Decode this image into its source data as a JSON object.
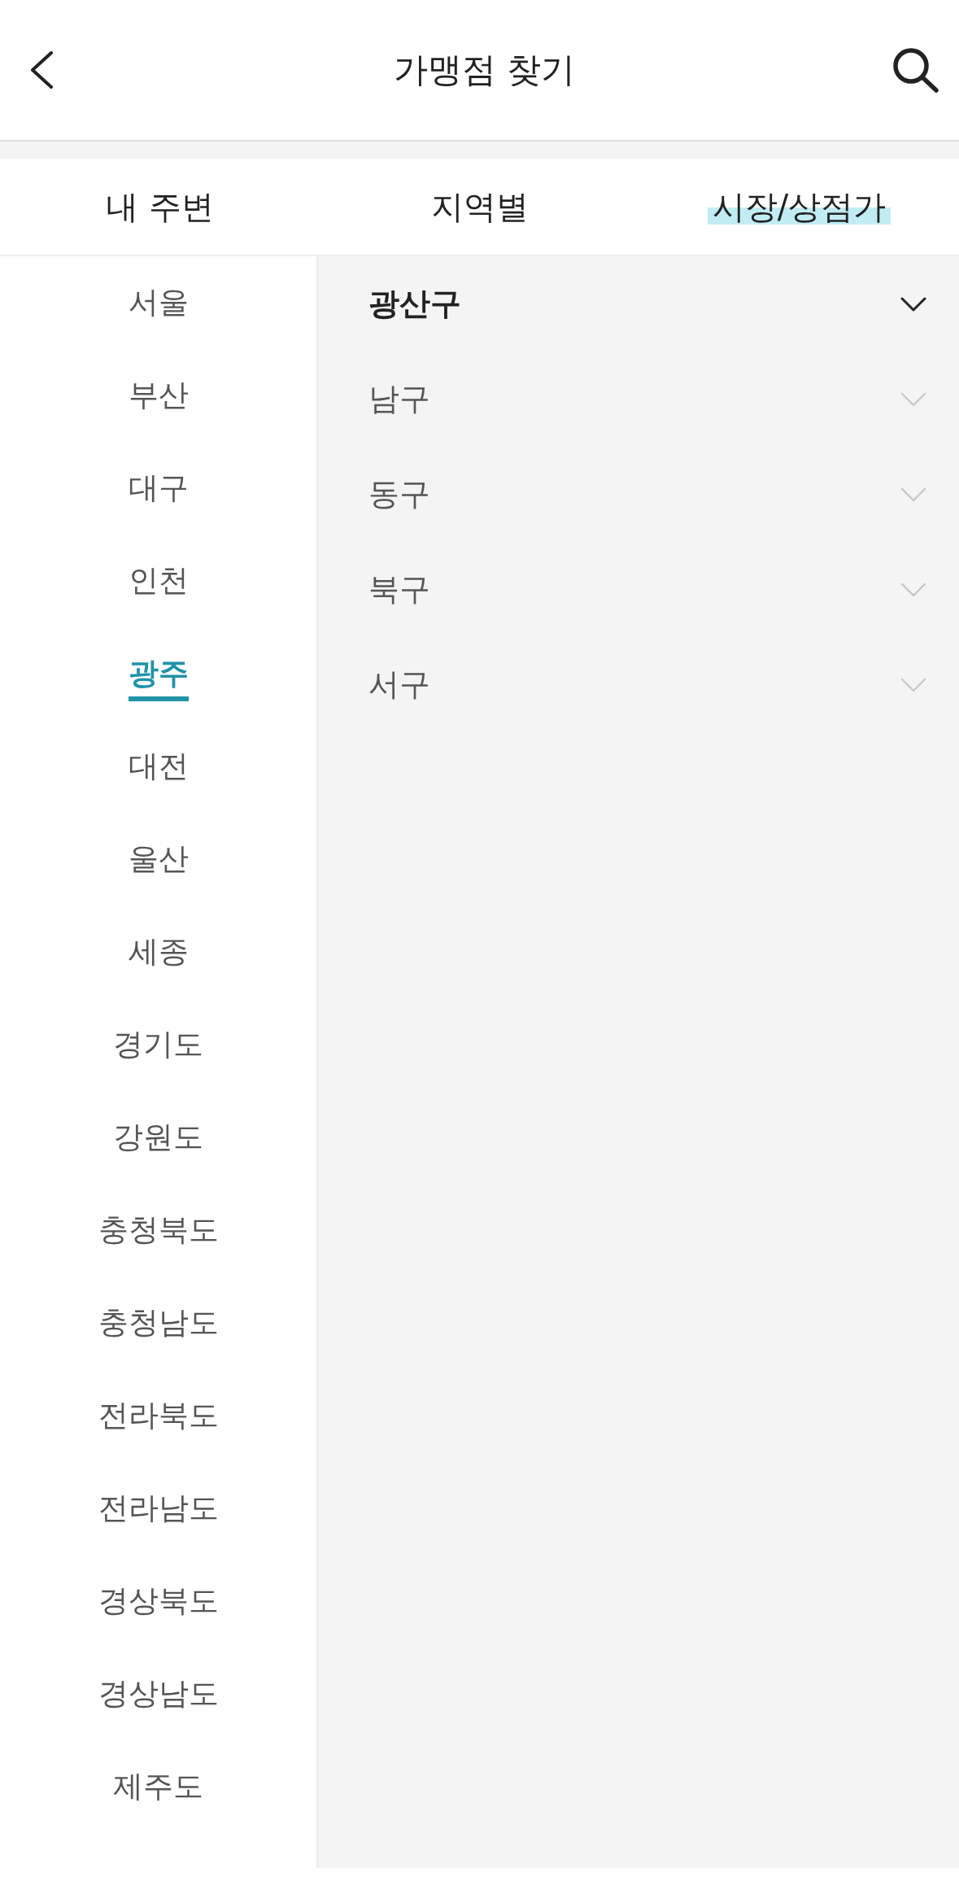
{
  "header": {
    "title": "가맹점 찾기"
  },
  "tabs": [
    {
      "label": "내 주변",
      "selected": false
    },
    {
      "label": "지역별",
      "selected": false
    },
    {
      "label": "시장/상점가",
      "selected": true
    }
  ],
  "regions": [
    {
      "label": "서울",
      "selected": false
    },
    {
      "label": "부산",
      "selected": false
    },
    {
      "label": "대구",
      "selected": false
    },
    {
      "label": "인천",
      "selected": false
    },
    {
      "label": "광주",
      "selected": true
    },
    {
      "label": "대전",
      "selected": false
    },
    {
      "label": "울산",
      "selected": false
    },
    {
      "label": "세종",
      "selected": false
    },
    {
      "label": "경기도",
      "selected": false
    },
    {
      "label": "강원도",
      "selected": false
    },
    {
      "label": "충청북도",
      "selected": false
    },
    {
      "label": "충청남도",
      "selected": false
    },
    {
      "label": "전라북도",
      "selected": false
    },
    {
      "label": "전라남도",
      "selected": false
    },
    {
      "label": "경상북도",
      "selected": false
    },
    {
      "label": "경상남도",
      "selected": false
    },
    {
      "label": "제주도",
      "selected": false
    }
  ],
  "districts": [
    {
      "label": "광산구",
      "selected": true
    },
    {
      "label": "남구",
      "selected": false
    },
    {
      "label": "동구",
      "selected": false
    },
    {
      "label": "북구",
      "selected": false
    },
    {
      "label": "서구",
      "selected": false
    }
  ]
}
